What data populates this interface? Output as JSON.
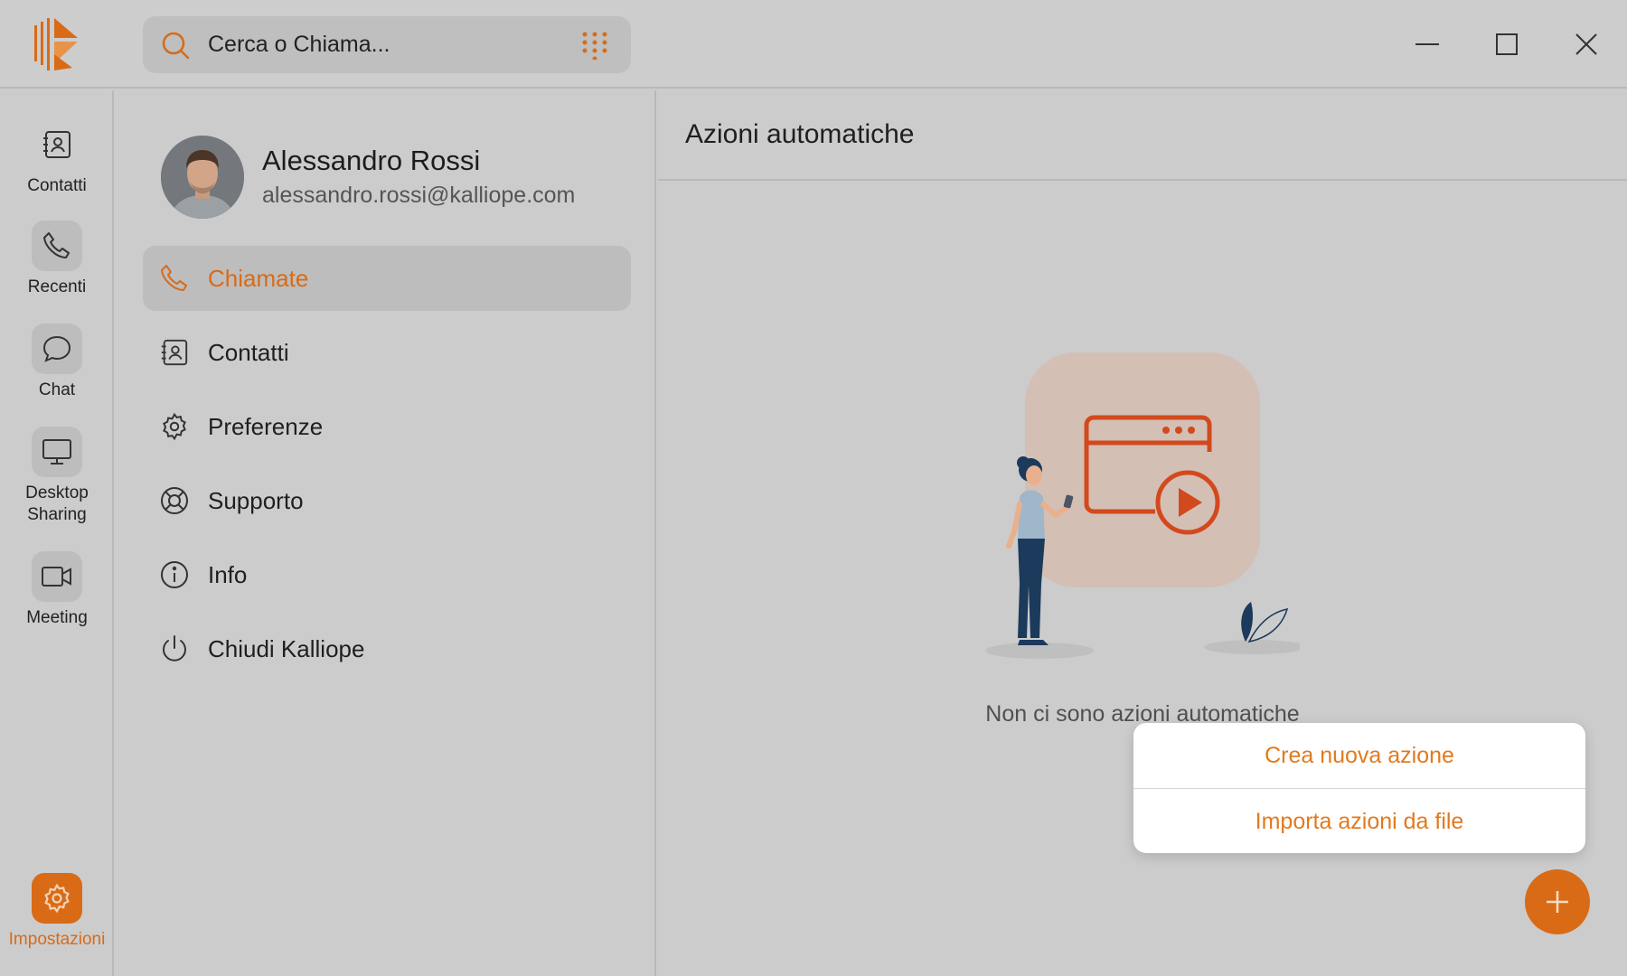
{
  "app": {
    "search": {
      "placeholder": "Cerca o Chiama..."
    }
  },
  "rail": {
    "items": [
      {
        "label": "Contatti",
        "icon": "contacts-icon"
      },
      {
        "label": "Recenti",
        "icon": "phone-icon"
      },
      {
        "label": "Chat",
        "icon": "chat-icon"
      },
      {
        "label": "Desktop Sharing",
        "icon": "monitor-icon"
      },
      {
        "label": "Meeting",
        "icon": "video-icon"
      },
      {
        "label": "Impostazioni",
        "icon": "gear-icon",
        "active": true
      }
    ]
  },
  "profile": {
    "name": "Alessandro Rossi",
    "email": "alessandro.rossi@kalliope.com"
  },
  "settings_menu": {
    "items": [
      {
        "label": "Chiamate",
        "icon": "phone-icon",
        "active": true
      },
      {
        "label": "Contatti",
        "icon": "contacts-icon"
      },
      {
        "label": "Preferenze",
        "icon": "gear-icon"
      },
      {
        "label": "Supporto",
        "icon": "lifebuoy-icon"
      },
      {
        "label": "Info",
        "icon": "info-icon"
      },
      {
        "label": "Chiudi Kalliope",
        "icon": "power-icon"
      }
    ]
  },
  "main": {
    "title": "Azioni automatiche",
    "empty_text": "Non ci sono azioni automatiche"
  },
  "popup": {
    "create_label": "Crea nuova azione",
    "import_label": "Importa azioni da file"
  },
  "colors": {
    "accent": "#d96b17",
    "popup_text": "#e27a1d",
    "background": "#cccccc"
  }
}
